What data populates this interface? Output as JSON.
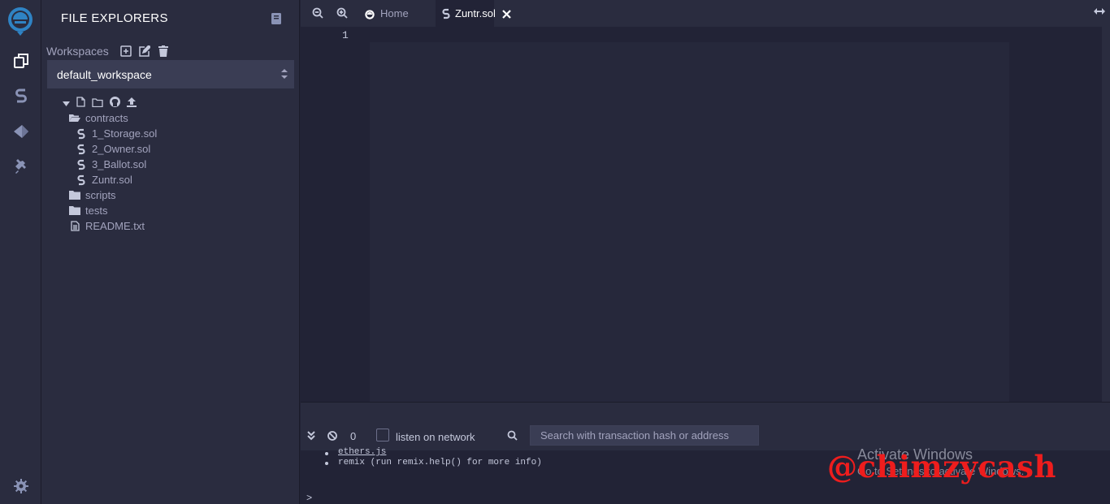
{
  "side_panel": {
    "title": "FILE EXPLORERS",
    "workspaces_label": "Workspaces",
    "workspace_selected": "default_workspace",
    "tree": {
      "contracts": "contracts",
      "files": [
        "1_Storage.sol",
        "2_Owner.sol",
        "3_Ballot.sol",
        "Zuntr.sol"
      ],
      "scripts": "scripts",
      "tests": "tests",
      "readme": "README.txt"
    }
  },
  "tabs": {
    "home": "Home",
    "active": "Zuntr.sol"
  },
  "editor": {
    "line_number": "1"
  },
  "terminal": {
    "pending_count": "0",
    "listen_label": "listen on network",
    "search_placeholder": "Search with transaction hash or address",
    "lines": [
      "ethers.js",
      "remix (run remix.help() for more info)"
    ],
    "prompt": ">"
  },
  "overlay": {
    "activate_title": "Activate Windows",
    "activate_sub": "Go to Settings to activate Windows.",
    "watermark": "@chimzycash"
  },
  "colors": {
    "accent": "#2a2c3f",
    "background": "#222336",
    "watermark": "#ee1d1d"
  }
}
